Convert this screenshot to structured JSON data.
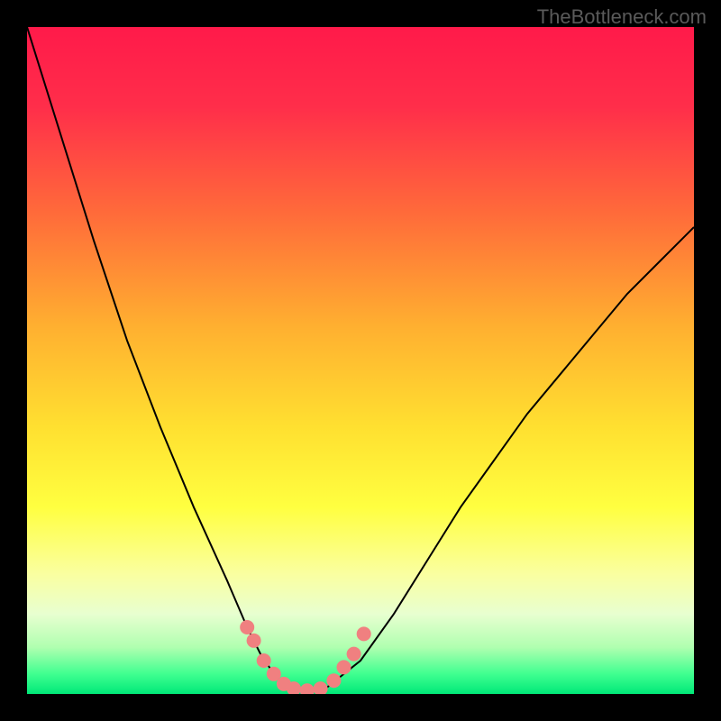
{
  "watermark": "TheBottleneck.com",
  "chart_data": {
    "type": "line",
    "title": "",
    "xlabel": "",
    "ylabel": "",
    "xlim": [
      0,
      100
    ],
    "ylim": [
      0,
      100
    ],
    "grid": false,
    "background_gradient": {
      "stops": [
        {
          "pos": 0.0,
          "color": "#ff1a4a"
        },
        {
          "pos": 0.12,
          "color": "#ff2e4a"
        },
        {
          "pos": 0.28,
          "color": "#ff6b3a"
        },
        {
          "pos": 0.45,
          "color": "#ffb030"
        },
        {
          "pos": 0.6,
          "color": "#ffe030"
        },
        {
          "pos": 0.72,
          "color": "#ffff40"
        },
        {
          "pos": 0.82,
          "color": "#faffa0"
        },
        {
          "pos": 0.88,
          "color": "#e8ffd0"
        },
        {
          "pos": 0.93,
          "color": "#b0ffb0"
        },
        {
          "pos": 0.97,
          "color": "#40ff90"
        },
        {
          "pos": 1.0,
          "color": "#00e878"
        }
      ]
    },
    "series": [
      {
        "name": "bottleneck-curve",
        "color": "#000000",
        "x": [
          0,
          5,
          10,
          15,
          20,
          25,
          30,
          33,
          35,
          37,
          39,
          41,
          43,
          45,
          50,
          55,
          60,
          65,
          70,
          75,
          80,
          85,
          90,
          95,
          100
        ],
        "y": [
          100,
          84,
          68,
          53,
          40,
          28,
          17,
          10,
          6,
          3,
          1,
          0.5,
          0.5,
          1,
          5,
          12,
          20,
          28,
          35,
          42,
          48,
          54,
          60,
          65,
          70
        ]
      }
    ],
    "markers": {
      "color": "#f08080",
      "radius": 8,
      "points": [
        {
          "x": 33,
          "y": 10
        },
        {
          "x": 34,
          "y": 8
        },
        {
          "x": 35.5,
          "y": 5
        },
        {
          "x": 37,
          "y": 3
        },
        {
          "x": 38.5,
          "y": 1.5
        },
        {
          "x": 40,
          "y": 0.8
        },
        {
          "x": 42,
          "y": 0.5
        },
        {
          "x": 44,
          "y": 0.8
        },
        {
          "x": 46,
          "y": 2
        },
        {
          "x": 47.5,
          "y": 4
        },
        {
          "x": 49,
          "y": 6
        },
        {
          "x": 50.5,
          "y": 9
        }
      ]
    }
  }
}
